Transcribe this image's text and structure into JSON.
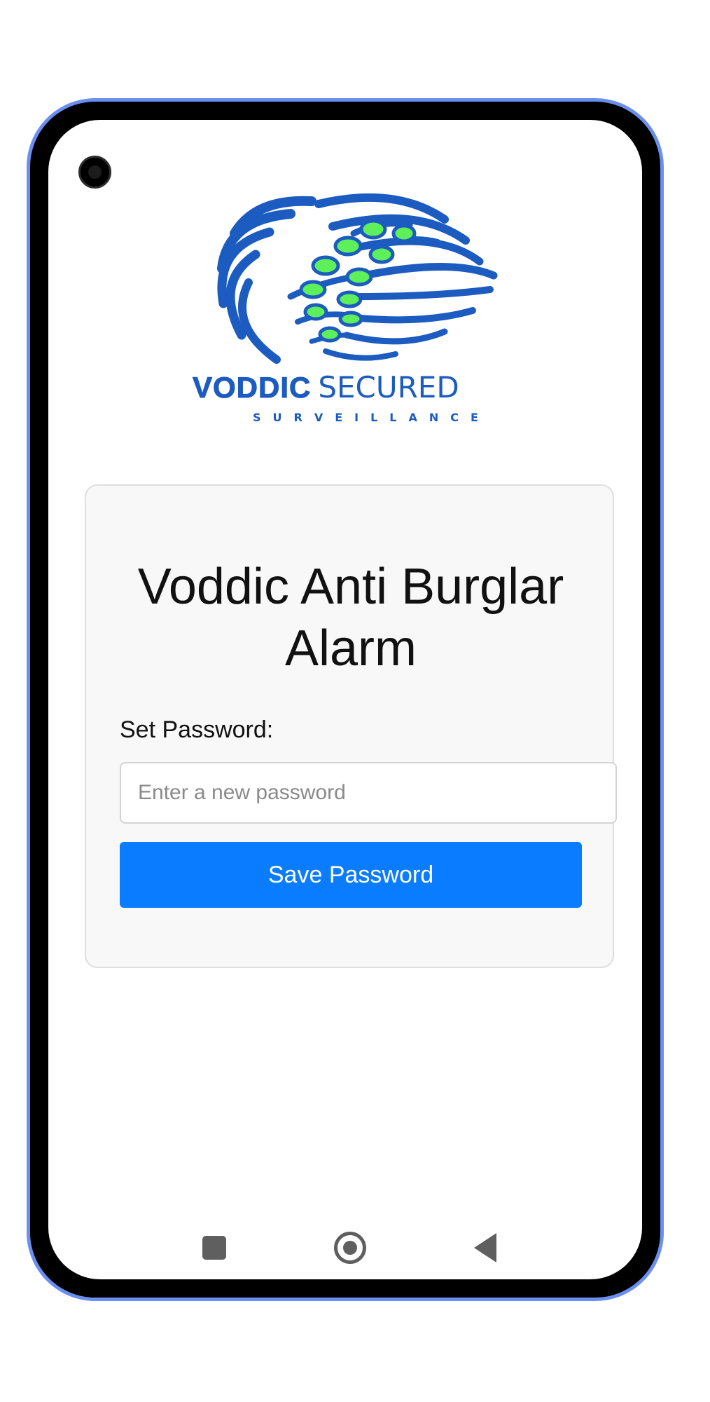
{
  "brand": {
    "name_bold": "VODDIC",
    "name_light": "SECURED",
    "tagline": "SURVEILLANCE",
    "logo_icon": "fingerprint-circuit-logo",
    "primary_color": "#1c5bbf",
    "accent_color": "#5ef05a"
  },
  "card": {
    "title": "Voddic Anti Burglar Alarm",
    "password_label": "Set Password:",
    "password_placeholder": "Enter a new password",
    "password_value": "",
    "save_button_label": "Save Password",
    "button_color": "#0a7cff"
  },
  "navbar": {
    "recents_icon": "square-icon",
    "home_icon": "circle-icon",
    "back_icon": "triangle-back-icon"
  }
}
